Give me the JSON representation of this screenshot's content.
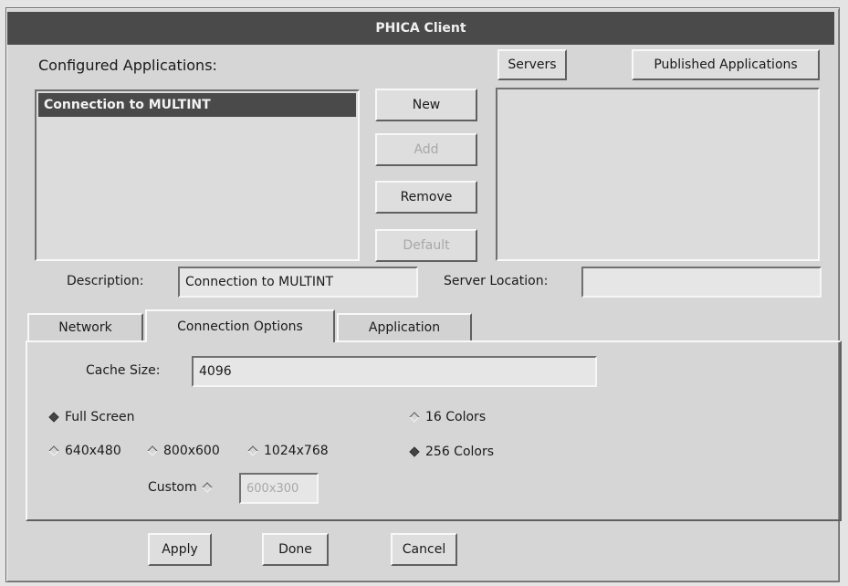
{
  "window": {
    "title": "PHICA Client"
  },
  "configured": {
    "label": "Configured Applications:",
    "items": [
      "Connection to MULTINT"
    ]
  },
  "buttons": {
    "new": "New",
    "add": "Add",
    "remove": "Remove",
    "default": "Default",
    "servers": "Servers",
    "published": "Published Applications"
  },
  "description": {
    "label": "Description:",
    "value": "Connection to MULTINT"
  },
  "server_location": {
    "label": "Server Location:",
    "value": ""
  },
  "tabs": [
    {
      "label": "Network"
    },
    {
      "label": "Connection Options"
    },
    {
      "label": "Application"
    }
  ],
  "connection_options": {
    "cache_label": "Cache Size:",
    "cache_value": "4096",
    "full_screen": "Full Screen",
    "res_640": "640x480",
    "res_800": "800x600",
    "res_1024": "1024x768",
    "custom_label": "Custom",
    "custom_value": "600x300",
    "colors_16": "16 Colors",
    "colors_256": "256 Colors"
  },
  "footer": {
    "apply": "Apply",
    "done": "Done",
    "cancel": "Cancel"
  }
}
